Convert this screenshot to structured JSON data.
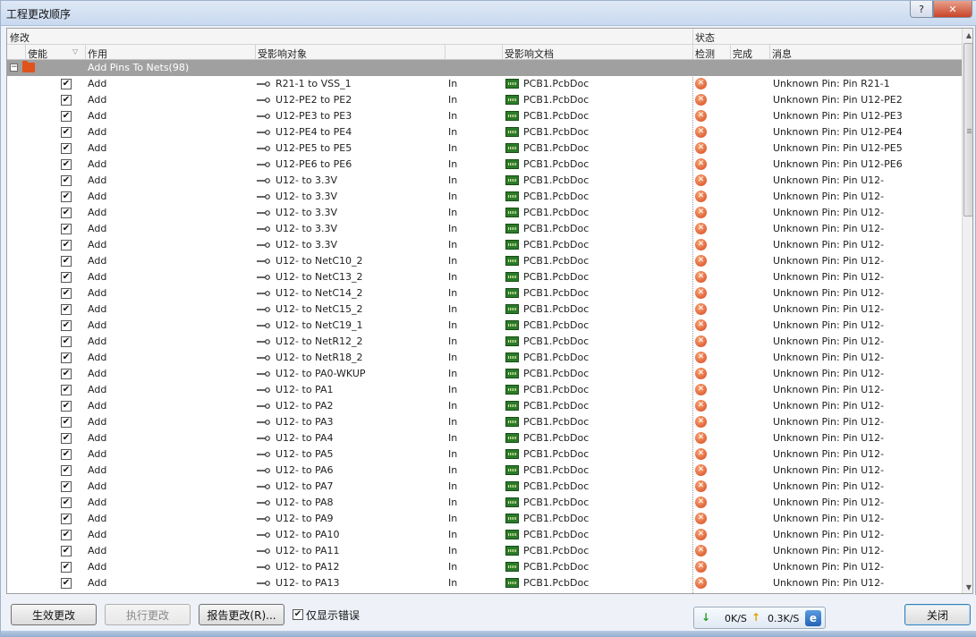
{
  "window": {
    "title": "工程更改顺序",
    "help_glyph": "?",
    "close_glyph": "✕"
  },
  "grid": {
    "group_headers": {
      "modify": "修改",
      "status": "状态"
    },
    "columns": {
      "enable": "使能",
      "action": "作用",
      "affected_object": "受影响对象",
      "affected_document": "受影响文档",
      "check": "检测",
      "done": "完成",
      "message": "消息"
    },
    "group": {
      "label": "Add Pins To Nets(98)",
      "expander": "−"
    },
    "rows": [
      {
        "action": "Add",
        "object": "R21-1 to VSS_1",
        "dir": "In",
        "doc": "PCB1.PcbDoc",
        "message": "Unknown Pin: Pin R21-1"
      },
      {
        "action": "Add",
        "object": "U12-PE2 to PE2",
        "dir": "In",
        "doc": "PCB1.PcbDoc",
        "message": "Unknown Pin: Pin U12-PE2"
      },
      {
        "action": "Add",
        "object": "U12-PE3 to PE3",
        "dir": "In",
        "doc": "PCB1.PcbDoc",
        "message": "Unknown Pin: Pin U12-PE3"
      },
      {
        "action": "Add",
        "object": "U12-PE4 to PE4",
        "dir": "In",
        "doc": "PCB1.PcbDoc",
        "message": "Unknown Pin: Pin U12-PE4"
      },
      {
        "action": "Add",
        "object": "U12-PE5 to PE5",
        "dir": "In",
        "doc": "PCB1.PcbDoc",
        "message": "Unknown Pin: Pin U12-PE5"
      },
      {
        "action": "Add",
        "object": "U12-PE6 to PE6",
        "dir": "In",
        "doc": "PCB1.PcbDoc",
        "message": "Unknown Pin: Pin U12-PE6"
      },
      {
        "action": "Add",
        "object": "U12- to 3.3V",
        "dir": "In",
        "doc": "PCB1.PcbDoc",
        "message": "Unknown Pin: Pin U12-"
      },
      {
        "action": "Add",
        "object": "U12- to 3.3V",
        "dir": "In",
        "doc": "PCB1.PcbDoc",
        "message": "Unknown Pin: Pin U12-"
      },
      {
        "action": "Add",
        "object": "U12- to 3.3V",
        "dir": "In",
        "doc": "PCB1.PcbDoc",
        "message": "Unknown Pin: Pin U12-"
      },
      {
        "action": "Add",
        "object": "U12- to 3.3V",
        "dir": "In",
        "doc": "PCB1.PcbDoc",
        "message": "Unknown Pin: Pin U12-"
      },
      {
        "action": "Add",
        "object": "U12- to 3.3V",
        "dir": "In",
        "doc": "PCB1.PcbDoc",
        "message": "Unknown Pin: Pin U12-"
      },
      {
        "action": "Add",
        "object": "U12- to NetC10_2",
        "dir": "In",
        "doc": "PCB1.PcbDoc",
        "message": "Unknown Pin: Pin U12-"
      },
      {
        "action": "Add",
        "object": "U12- to NetC13_2",
        "dir": "In",
        "doc": "PCB1.PcbDoc",
        "message": "Unknown Pin: Pin U12-"
      },
      {
        "action": "Add",
        "object": "U12- to NetC14_2",
        "dir": "In",
        "doc": "PCB1.PcbDoc",
        "message": "Unknown Pin: Pin U12-"
      },
      {
        "action": "Add",
        "object": "U12- to NetC15_2",
        "dir": "In",
        "doc": "PCB1.PcbDoc",
        "message": "Unknown Pin: Pin U12-"
      },
      {
        "action": "Add",
        "object": "U12- to NetC19_1",
        "dir": "In",
        "doc": "PCB1.PcbDoc",
        "message": "Unknown Pin: Pin U12-"
      },
      {
        "action": "Add",
        "object": "U12- to NetR12_2",
        "dir": "In",
        "doc": "PCB1.PcbDoc",
        "message": "Unknown Pin: Pin U12-"
      },
      {
        "action": "Add",
        "object": "U12- to NetR18_2",
        "dir": "In",
        "doc": "PCB1.PcbDoc",
        "message": "Unknown Pin: Pin U12-"
      },
      {
        "action": "Add",
        "object": "U12- to PA0-WKUP",
        "dir": "In",
        "doc": "PCB1.PcbDoc",
        "message": "Unknown Pin: Pin U12-"
      },
      {
        "action": "Add",
        "object": "U12- to PA1",
        "dir": "In",
        "doc": "PCB1.PcbDoc",
        "message": "Unknown Pin: Pin U12-"
      },
      {
        "action": "Add",
        "object": "U12- to PA2",
        "dir": "In",
        "doc": "PCB1.PcbDoc",
        "message": "Unknown Pin: Pin U12-"
      },
      {
        "action": "Add",
        "object": "U12- to PA3",
        "dir": "In",
        "doc": "PCB1.PcbDoc",
        "message": "Unknown Pin: Pin U12-"
      },
      {
        "action": "Add",
        "object": "U12- to PA4",
        "dir": "In",
        "doc": "PCB1.PcbDoc",
        "message": "Unknown Pin: Pin U12-"
      },
      {
        "action": "Add",
        "object": "U12- to PA5",
        "dir": "In",
        "doc": "PCB1.PcbDoc",
        "message": "Unknown Pin: Pin U12-"
      },
      {
        "action": "Add",
        "object": "U12- to PA6",
        "dir": "In",
        "doc": "PCB1.PcbDoc",
        "message": "Unknown Pin: Pin U12-"
      },
      {
        "action": "Add",
        "object": "U12- to PA7",
        "dir": "In",
        "doc": "PCB1.PcbDoc",
        "message": "Unknown Pin: Pin U12-"
      },
      {
        "action": "Add",
        "object": "U12- to PA8",
        "dir": "In",
        "doc": "PCB1.PcbDoc",
        "message": "Unknown Pin: Pin U12-"
      },
      {
        "action": "Add",
        "object": "U12- to PA9",
        "dir": "In",
        "doc": "PCB1.PcbDoc",
        "message": "Unknown Pin: Pin U12-"
      },
      {
        "action": "Add",
        "object": "U12- to PA10",
        "dir": "In",
        "doc": "PCB1.PcbDoc",
        "message": "Unknown Pin: Pin U12-"
      },
      {
        "action": "Add",
        "object": "U12- to PA11",
        "dir": "In",
        "doc": "PCB1.PcbDoc",
        "message": "Unknown Pin: Pin U12-"
      },
      {
        "action": "Add",
        "object": "U12- to PA12",
        "dir": "In",
        "doc": "PCB1.PcbDoc",
        "message": "Unknown Pin: Pin U12-"
      },
      {
        "action": "Add",
        "object": "U12- to PA13",
        "dir": "In",
        "doc": "PCB1.PcbDoc",
        "message": "Unknown Pin: Pin U12-"
      }
    ],
    "checkbox_glyph": "✔",
    "error_glyph": "✕"
  },
  "footer": {
    "validate_button": "生效更改",
    "execute_button": "执行更改",
    "report_button": "报告更改(R)...",
    "only_errors_label": "仅显示错误",
    "only_errors_checked": true,
    "close_button": "关闭"
  },
  "network": {
    "down_glyph": "↓",
    "down_speed": "0K/S",
    "up_glyph": "↑",
    "up_speed": "0.3K/S",
    "ie_glyph": "e"
  },
  "colors": {
    "group_row_bg": "#a0a0a0",
    "error_icon": "#d8441c",
    "pcb_icon": "#2a7a2a",
    "window_bg": "#eef2f8"
  }
}
